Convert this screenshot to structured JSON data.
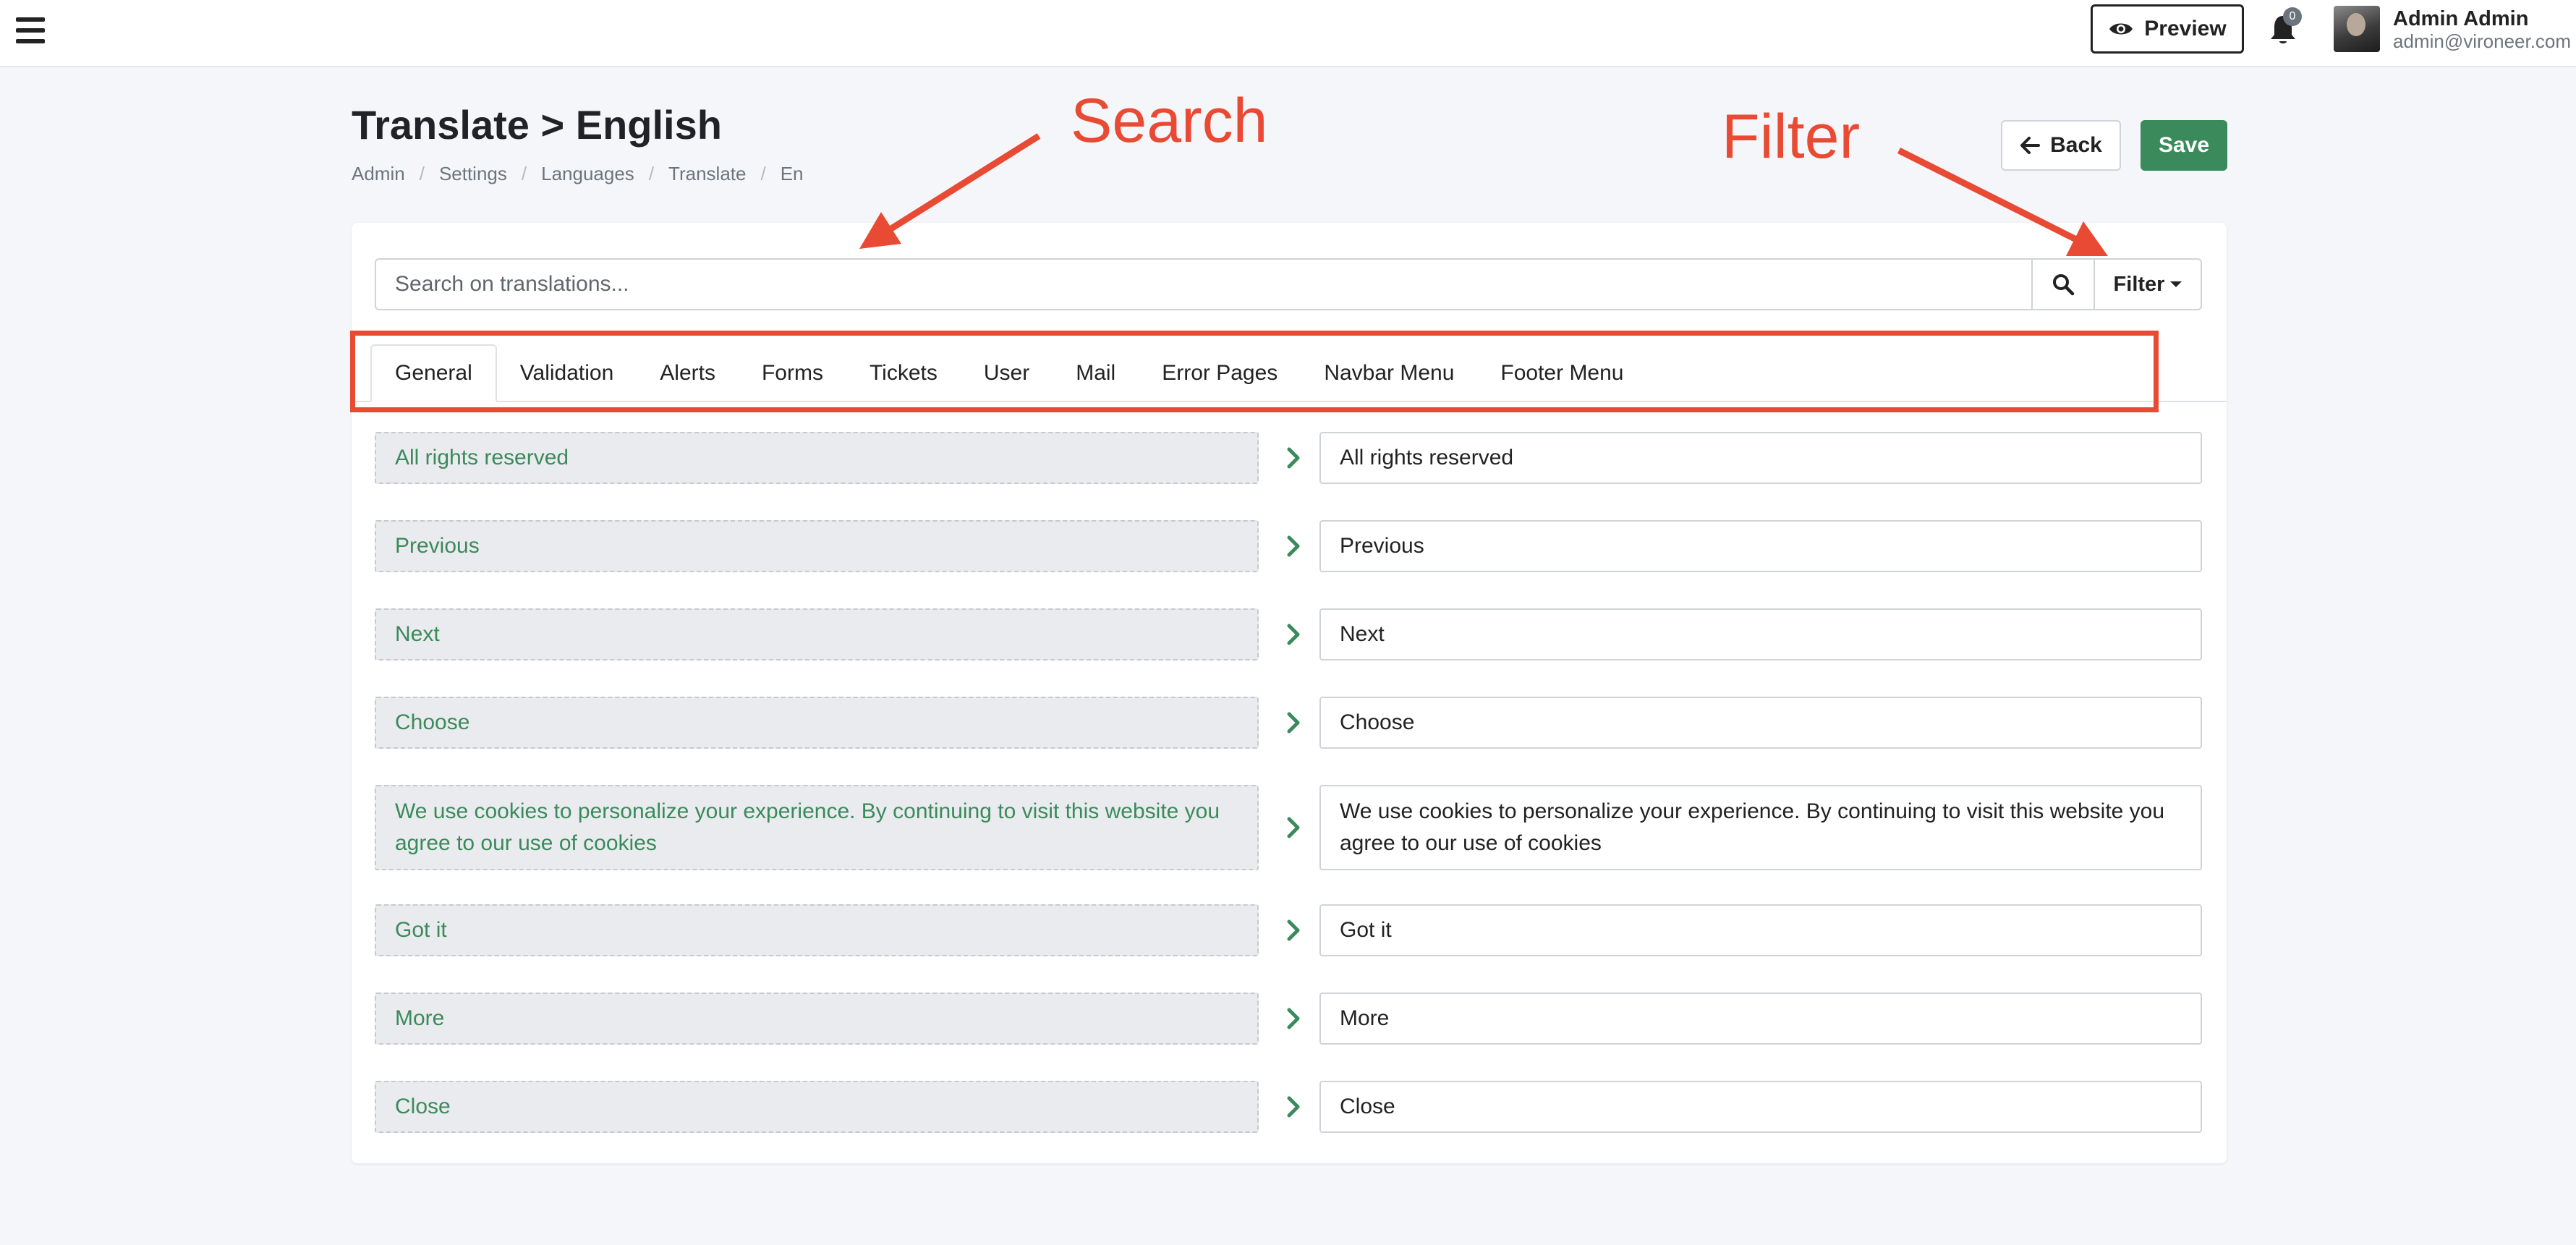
{
  "topbar": {
    "preview_label": "Preview",
    "notification_count": "0",
    "user_name": "Admin Admin",
    "user_email": "admin@vironeer.com"
  },
  "header": {
    "title": "Translate > English",
    "breadcrumb": [
      "Admin",
      "Settings",
      "Languages",
      "Translate",
      "En"
    ],
    "back_label": "Back",
    "save_label": "Save"
  },
  "annotations": {
    "search": "Search",
    "filter": "Filter"
  },
  "search": {
    "placeholder": "Search on translations...",
    "filter_label": "Filter"
  },
  "tabs": [
    "General",
    "Validation",
    "Alerts",
    "Forms",
    "Tickets",
    "User",
    "Mail",
    "Error Pages",
    "Navbar Menu",
    "Footer Menu"
  ],
  "active_tab": "General",
  "translations": [
    {
      "source": "All rights reserved",
      "value": "All rights reserved"
    },
    {
      "source": "Previous",
      "value": "Previous"
    },
    {
      "source": "Next",
      "value": "Next"
    },
    {
      "source": "Choose",
      "value": "Choose"
    },
    {
      "source": "We use cookies to personalize your experience. By continuing to visit this website you agree to our use of cookies",
      "value": "We use cookies to personalize your experience. By continuing to visit this website you agree to our use of cookies"
    },
    {
      "source": "Got it",
      "value": "Got it"
    },
    {
      "source": "More",
      "value": "More"
    },
    {
      "source": "Close",
      "value": "Close"
    }
  ],
  "colors": {
    "accent_green": "#3a8a5c",
    "annotation_red": "#e84a34"
  }
}
